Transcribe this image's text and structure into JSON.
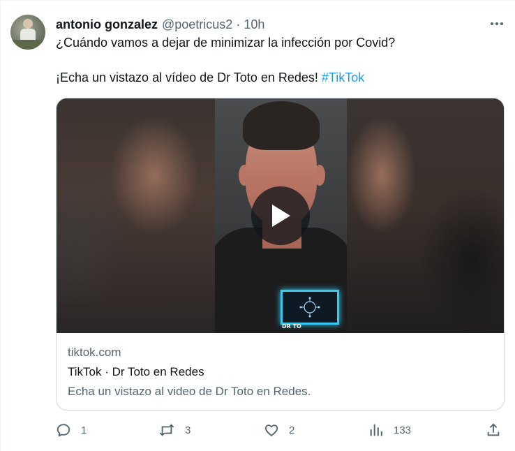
{
  "author": {
    "name": "antonio gonzalez",
    "handle": "@poetricus2",
    "separator": "·",
    "time": "10h"
  },
  "tweet": {
    "line1": "¿Cuándo vamos a dejar de minimizar la infección por Covid?",
    "line2": "¡Echa un vistazo al vídeo de Dr Toto en Redes!",
    "hashtag": "#TikTok"
  },
  "card": {
    "domain": "tiktok.com",
    "title": "TikTok · Dr Toto en Redes",
    "description": "Echa un vistazo al video de Dr Toto en Redes.",
    "video_watermark": "DR TO"
  },
  "actions": {
    "reply_count": "1",
    "retweet_count": "3",
    "like_count": "2",
    "views_count": "133"
  },
  "colors": {
    "text_primary": "#0f1419",
    "text_secondary": "#536471",
    "link": "#1d9bf0",
    "border": "#cfd9de"
  },
  "icons": [
    "more-icon",
    "play-icon",
    "reply-icon",
    "retweet-icon",
    "like-icon",
    "views-icon",
    "share-icon"
  ]
}
